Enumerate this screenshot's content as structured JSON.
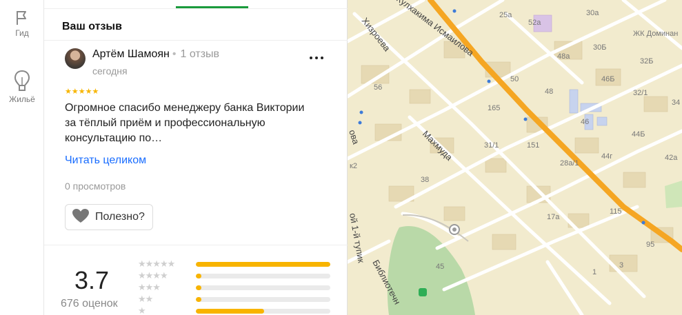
{
  "sidebar": {
    "items": [
      {
        "label": "Гид",
        "icon": "flag-icon"
      },
      {
        "label": "Жильё",
        "icon": "home-building-icon"
      }
    ]
  },
  "panel": {
    "section_title": "Ваш отзыв",
    "review": {
      "author": "Артём Шамоян",
      "author_reviews": "1 отзыв",
      "date": "сегодня",
      "rating_stars": "★★★★★",
      "text": "Огромное спасибо менеджеру банка Виктории за тёплый приём и профессиональную консультацию по…",
      "read_more": "Читать целиком",
      "views": "0 просмотров",
      "useful_label": "Полезно?"
    },
    "rating": {
      "value": "3.7",
      "count": "676 оценок",
      "distribution": [
        {
          "stars": "★★★★★",
          "fraction": 1.0
        },
        {
          "stars": "★★★★",
          "fraction": 0.04
        },
        {
          "stars": "★★★",
          "fraction": 0.04
        },
        {
          "stars": "★★",
          "fraction": 0.04
        },
        {
          "stars": "★",
          "fraction": 0.51
        }
      ]
    }
  },
  "map": {
    "street_labels": [
      "Кулхакима Исмаилова",
      "Хизроева",
      "Махмуда",
      "ой 1-й тупик",
      "Библиотечн",
      "ова"
    ],
    "house_labels": [
      "25а",
      "30а",
      "52а",
      "ЖК Доминан",
      "48а",
      "30Б",
      "32Б",
      "50",
      "46Б",
      "56",
      "165",
      "48",
      "32/1",
      "46",
      "34",
      "44Б",
      "31/1",
      "151",
      "28а/1",
      "44г",
      "42а",
      "к2",
      "38",
      "17а",
      "115",
      "95",
      "3",
      "45",
      "1"
    ],
    "colors": {
      "background": "#f2ebce",
      "major_road": "#f5a623",
      "road": "#ffffff",
      "park": "#b9d9a8",
      "building": "#e9dcb8",
      "metro": "#3d7bd9"
    }
  }
}
